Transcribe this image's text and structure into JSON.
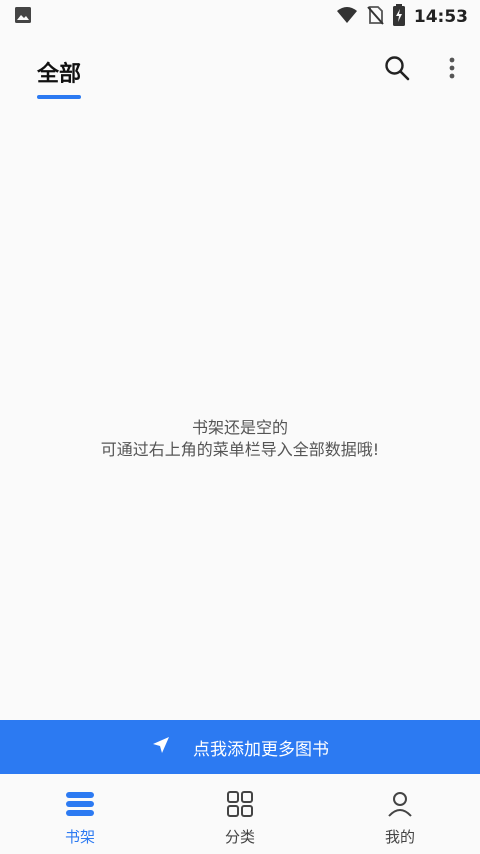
{
  "status_bar": {
    "time": "14:53",
    "icons": [
      "image-icon",
      "wifi-icon",
      "no-sim-icon",
      "battery-charging-icon"
    ]
  },
  "header": {
    "tab_label": "全部",
    "accent_color": "#2c7af2",
    "actions": [
      "search-icon",
      "more-vert-icon"
    ]
  },
  "empty_state": {
    "line1": "书架还是空的",
    "line2": "可通过右上角的菜单栏导入全部数据哦!"
  },
  "add_books_bar": {
    "label": "点我添加更多图书",
    "icon": "send-arrow-icon"
  },
  "bottom_nav": {
    "items": [
      {
        "label": "书架",
        "icon": "bookshelf-icon",
        "active": true
      },
      {
        "label": "分类",
        "icon": "grid-icon",
        "active": false
      },
      {
        "label": "我的",
        "icon": "profile-icon",
        "active": false
      }
    ]
  }
}
